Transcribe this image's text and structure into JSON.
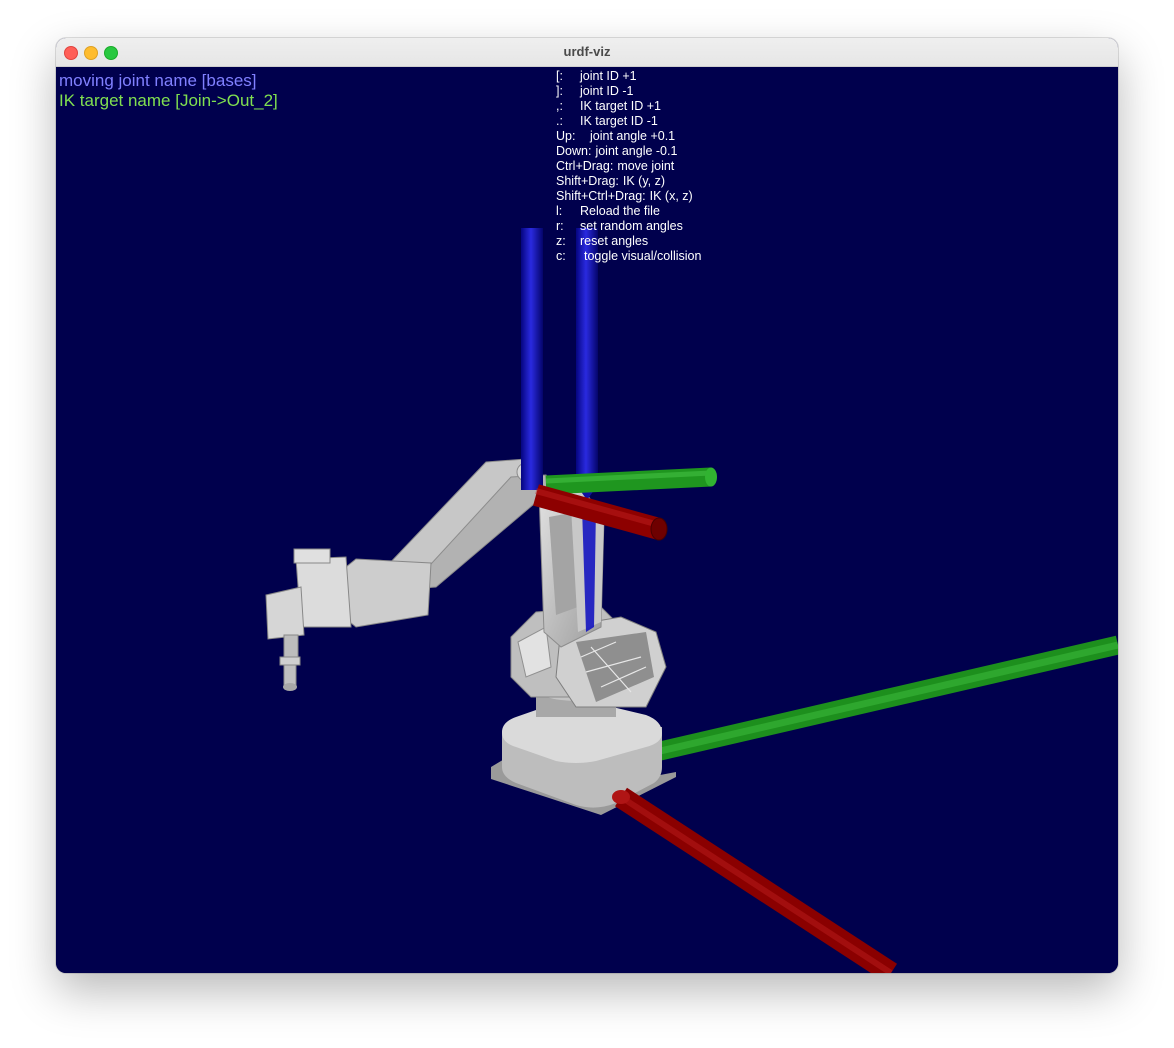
{
  "window": {
    "title": "urdf-viz",
    "buttons": [
      "close",
      "minimize",
      "maximize"
    ]
  },
  "status": {
    "moving_joint": "moving joint name [bases]",
    "ik_target": "IK target name [Join->Out_2]"
  },
  "help": [
    {
      "key": "[:",
      "action": "joint ID +1"
    },
    {
      "key": "]:",
      "action": "joint ID -1"
    },
    {
      "key": ",:",
      "action": "IK target ID +1"
    },
    {
      "key": ".:",
      "action": "IK target ID -1"
    },
    {
      "key": "Up:",
      "action": "joint angle +0.1"
    },
    {
      "key": "Down:",
      "action": "joint angle -0.1"
    },
    {
      "key": "Ctrl+Drag:",
      "action": "move joint"
    },
    {
      "key": "Shift+Drag:",
      "action": "IK (y, z)"
    },
    {
      "key": "Shift+Ctrl+Drag:",
      "action": "IK (x, z)"
    },
    {
      "key": "l:",
      "action": "Reload the file"
    },
    {
      "key": "r:",
      "action": "set random angles"
    },
    {
      "key": "z:",
      "action": "reset angles"
    },
    {
      "key": "c:",
      "action": "toggle visual/collision"
    }
  ],
  "colors": {
    "background": "#00004d",
    "axis_x": "#9b0000",
    "axis_y": "#1f9a1f",
    "axis_z": "#0a0ab0",
    "robot": "#c9c9c9",
    "moving_joint_text": "#8080ff",
    "ik_target_text": "#80e050"
  }
}
